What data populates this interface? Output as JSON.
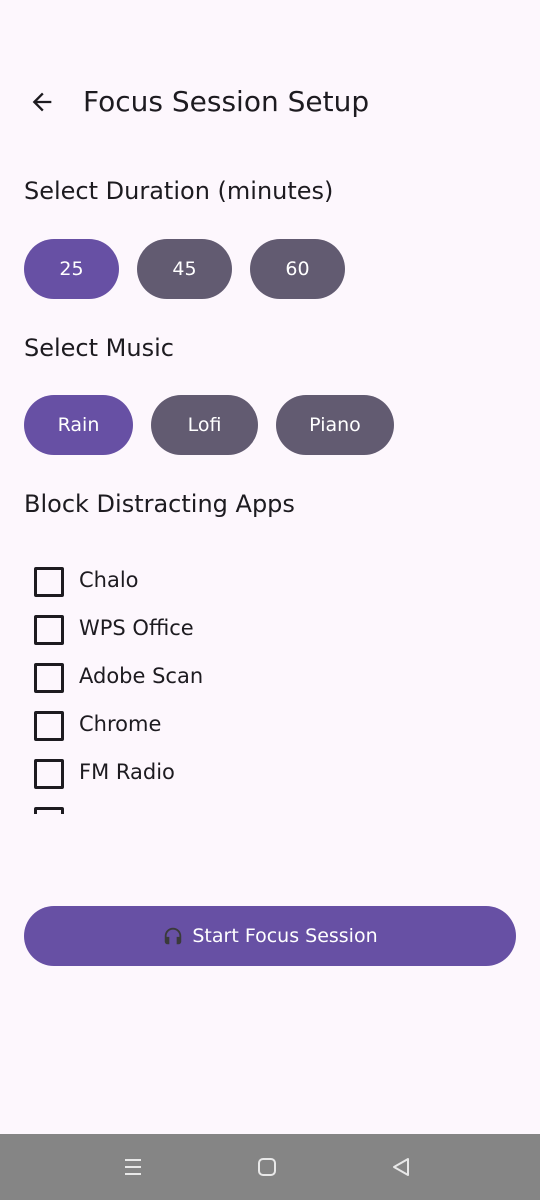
{
  "app_bar": {
    "title": "Focus Session Setup"
  },
  "duration": {
    "title": "Select Duration (minutes)",
    "options": [
      "25",
      "45",
      "60"
    ],
    "selected_index": 0
  },
  "music": {
    "title": "Select Music",
    "options": [
      "Rain",
      "Lofi",
      "Piano"
    ],
    "selected_index": 0
  },
  "block_apps": {
    "title": "Block Distracting Apps",
    "apps": [
      {
        "label": "Chalo",
        "checked": false
      },
      {
        "label": "WPS Office",
        "checked": false
      },
      {
        "label": "Adobe Scan",
        "checked": false
      },
      {
        "label": "Chrome",
        "checked": false
      },
      {
        "label": "FM Radio",
        "checked": false
      }
    ]
  },
  "start_button": {
    "label": "Start Focus Session",
    "icon": "headphones-icon"
  },
  "colors": {
    "background": "#fdf7fd",
    "primary": "#6750a4",
    "secondary": "#625b71",
    "on_surface": "#1d1b20",
    "nav_bar": "#858585"
  },
  "nav_bar": {
    "icons": [
      "recents-icon",
      "home-icon",
      "back-triangle-icon"
    ]
  }
}
